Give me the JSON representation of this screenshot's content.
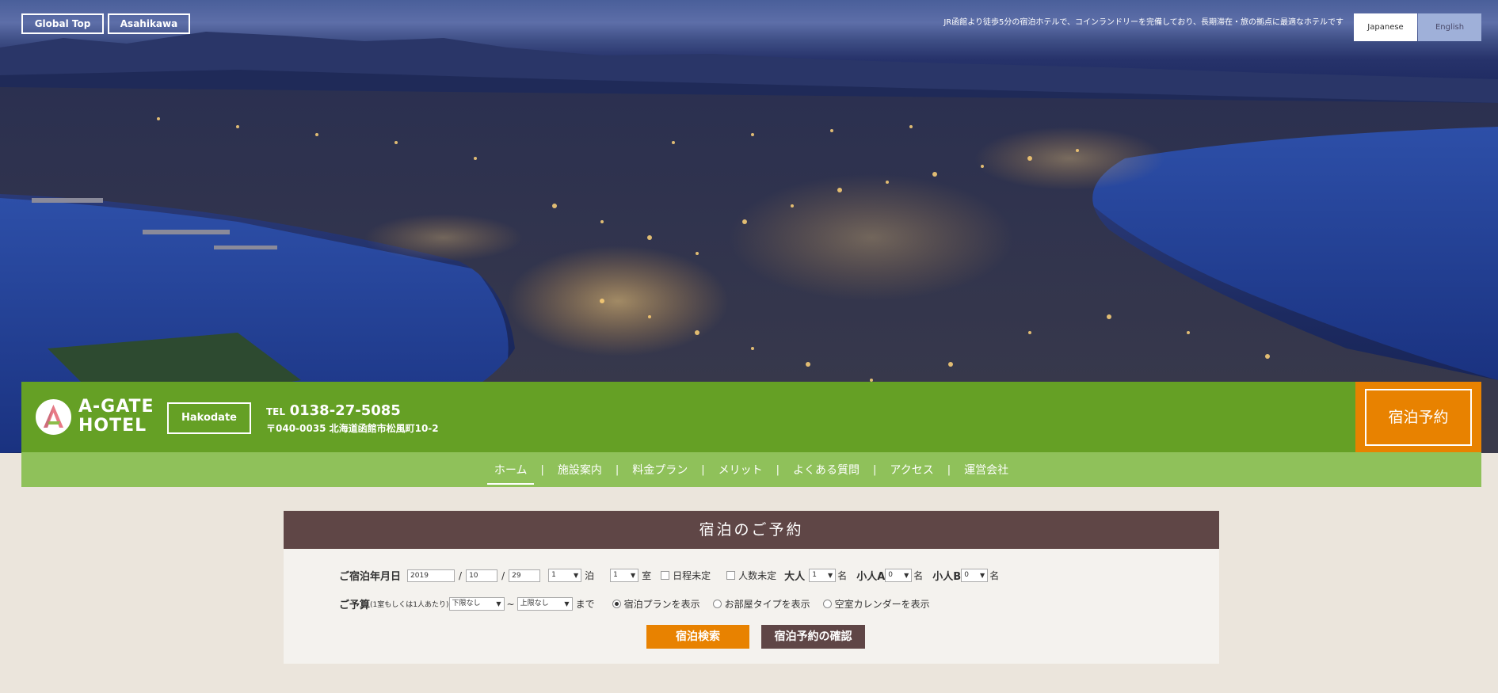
{
  "top_links": {
    "global": "Global Top",
    "asahikawa": "Asahikawa"
  },
  "tagline": "JR函館より徒歩5分の宿泊ホテルで、コインランドリーを完備しており、長期滞在・旅の拠点に最適なホテルです",
  "languages": {
    "japanese": "Japanese",
    "english": "English"
  },
  "header": {
    "logo_line1": "A-GATE",
    "logo_line2": "HOTEL",
    "branch": "Hakodate",
    "tel_label": "TEL",
    "tel_number": "0138-27-5085",
    "address": "〒040-0035 北海道函館市松風町10-2",
    "reserve_label": "宿泊予約"
  },
  "nav": {
    "items": [
      "ホーム",
      "施設案内",
      "料金プラン",
      "メリット",
      "よくある質問",
      "アクセス",
      "運営会社"
    ],
    "separator": "|"
  },
  "booking": {
    "title": "宿泊のご予約",
    "date_label": "ご宿泊年月日",
    "year": "2019",
    "month": "10",
    "day": "29",
    "slash": "/",
    "nights_value": "1",
    "nights_unit": "泊",
    "rooms_value": "1",
    "rooms_unit": "室",
    "date_undecided": "日程未定",
    "people_undecided": "人数未定",
    "adult_label": "大人",
    "adult_value": "1",
    "child_a_label": "小人A",
    "child_a_value": "0",
    "child_b_label": "小人B",
    "child_b_value": "0",
    "person_unit": "名",
    "budget_label": "ご予算",
    "budget_note": "(1室もしくは1人あたり)",
    "budget_min": "下限なし",
    "budget_dash": "~",
    "budget_max": "上限なし",
    "budget_until": "まで",
    "view_plan": "宿泊プランを表示",
    "view_room": "お部屋タイプを表示",
    "view_calendar": "空室カレンダーを表示",
    "search_button": "宿泊検索",
    "confirm_button": "宿泊予約の確認"
  },
  "colors": {
    "header_green": "#65a025",
    "nav_green": "#8fc15a",
    "orange": "#e88200",
    "brown": "#5f4646",
    "page_bg": "#ebe5dc"
  }
}
